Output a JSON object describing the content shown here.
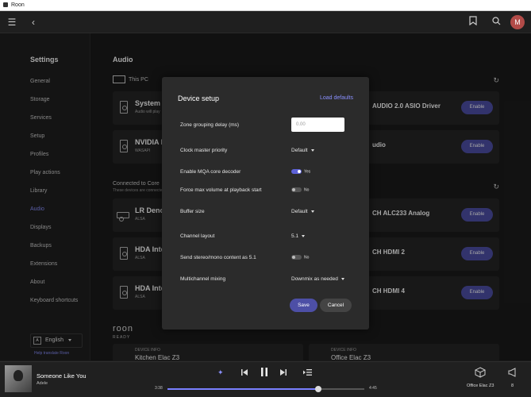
{
  "window": {
    "title": "Roon"
  },
  "sidebar": {
    "title": "Settings",
    "items": [
      {
        "label": "General",
        "active": false
      },
      {
        "label": "Storage",
        "active": false
      },
      {
        "label": "Services",
        "active": false
      },
      {
        "label": "Setup",
        "active": false
      },
      {
        "label": "Profiles",
        "active": false
      },
      {
        "label": "Play actions",
        "active": false
      },
      {
        "label": "Library",
        "active": false
      },
      {
        "label": "Audio",
        "active": true
      },
      {
        "label": "Displays",
        "active": false
      },
      {
        "label": "Backups",
        "active": false
      },
      {
        "label": "Extensions",
        "active": false
      },
      {
        "label": "About",
        "active": false
      },
      {
        "label": "Keyboard shortcuts",
        "active": false
      }
    ],
    "language": "English",
    "help_translate": "Help translate Roon"
  },
  "user": {
    "avatar_letter": "M"
  },
  "main": {
    "title": "Audio",
    "this_pc": "This PC",
    "cards": [
      {
        "name": "System C",
        "sub": "Audio will play",
        "right": "AUDIO 2.0 ASIO Driver",
        "enable": "Enable"
      },
      {
        "name": "NVIDIA I",
        "sub": "WASAPI",
        "right": "udio",
        "enable": "Enable"
      }
    ],
    "connected_title": "Connected to Core",
    "connected_sub": "These devices are connected",
    "connected_cards": [
      {
        "name": "LR Denon",
        "sub": "ALSA",
        "right": "CH ALC233 Analog",
        "enable": "Enable"
      },
      {
        "name": "HDA Inte",
        "sub": "ALSA",
        "right": "CH HDMI 2",
        "enable": "Enable"
      },
      {
        "name": "HDA Inte",
        "sub": "ALSA",
        "right": "CH HDMI 4",
        "enable": "Enable"
      }
    ],
    "roon_logo": "roon",
    "roon_ready": "READY",
    "device_info": [
      {
        "label": "DEVICE INFO",
        "name": "Kitchen Elac Z3"
      },
      {
        "label": "DEVICE INFO",
        "name": "Office Elac Z3"
      }
    ]
  },
  "dialog": {
    "title": "Device setup",
    "load_defaults": "Load defaults",
    "zone_grouping": {
      "label": "Zone grouping delay (ms)",
      "placeholder": "0.00"
    },
    "clock_master": {
      "label": "Clock master priority",
      "value": "Default"
    },
    "mqa": {
      "label": "Enable MQA core decoder",
      "on": true,
      "state_text": "Yes"
    },
    "force_max": {
      "label": "Force max volume at playback start",
      "on": false,
      "state_text": "No"
    },
    "buffer": {
      "label": "Buffer size",
      "value": "Default"
    },
    "channel_layout": {
      "label": "Channel layout",
      "value": "5.1"
    },
    "stereo_mono": {
      "label": "Send stereo/mono content as 5.1",
      "on": false,
      "state_text": "No"
    },
    "multichannel": {
      "label": "Multichannel mixing",
      "value": "Downmix as needed"
    },
    "save": "Save",
    "cancel": "Cancel"
  },
  "player": {
    "song": "Someone Like You",
    "artist": "Adele",
    "elapsed": "3:38",
    "total": "4:45",
    "progress": 0.766,
    "zone": "Office Elac Z3",
    "volume": "8"
  }
}
